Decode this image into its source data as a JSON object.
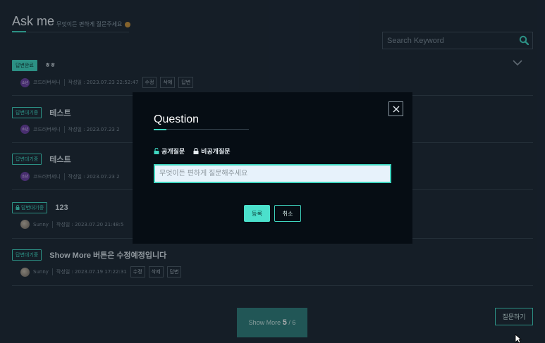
{
  "header": {
    "title": "Ask me",
    "subtitle": "무엇이든 편하게 질문주세요"
  },
  "search": {
    "placeholder": "Search Keyword"
  },
  "items": [
    {
      "badge": "답변완료",
      "title": "ㅎㅎ",
      "avatar": "소년",
      "author": "코드러버써니",
      "date": "작성일 : 2023.07.23 22:52:47",
      "actions": [
        "수정",
        "삭제",
        "답변"
      ]
    },
    {
      "badge": "답변대기중",
      "title": "테스트",
      "avatar": "소년",
      "author": "코드러버써니",
      "date": "작성일 : 2023.07.23 2"
    },
    {
      "badge": "답변대기중",
      "title": "테스트",
      "avatar": "소년",
      "author": "코드러버써니",
      "date": "작성일 : 2023.07.23 2"
    },
    {
      "badge": "답변대기중",
      "title": "123",
      "author": "Sunny",
      "date": "작성일 : 2023.07.20 21:48:5"
    },
    {
      "badge": "답변대기중",
      "title": "Show More 버튼은 수정예정입니다",
      "author": "Sunny",
      "date": "작성일 : 2023.07.19 17:22:31",
      "actions": [
        "수정",
        "삭제",
        "답변"
      ]
    }
  ],
  "pagination": {
    "label": "Show More",
    "current": "5",
    "total": "/ 6"
  },
  "ask_button": "질문하기",
  "modal": {
    "title": "Question",
    "public_label": "공개질문",
    "private_label": "비공개질문",
    "input_placeholder": "무엇이든 편하게 질문해주세요",
    "submit_label": "등록",
    "cancel_label": "취소"
  },
  "colors": {
    "accent": "#3fd6c0",
    "background": "#1c2732",
    "modal_bg": "#060d14"
  }
}
